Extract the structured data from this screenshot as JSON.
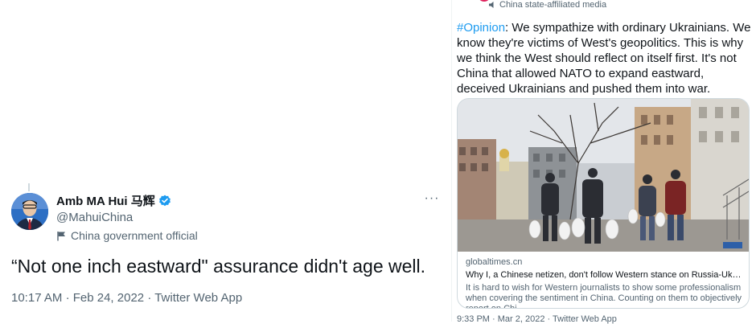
{
  "left_tweet": {
    "author_name": "Amb MA Hui 马辉",
    "handle": "@MahuiChina",
    "label": "China government official",
    "text": "“Not one inch eastward\" assurance didn't age well.",
    "time": "10:17 AM",
    "date": "Feb 24, 2022",
    "source": "Twitter Web App",
    "more": "···"
  },
  "right_tweet": {
    "state_label": "China state-affiliated media",
    "hashtag": "#Opinion",
    "text": ": We sympathize with ordinary Ukrainians. We know they're victims of West's geopolitics. This is why we think the West should reflect on itself first. It's not China that allowed NATO to expand eastward, deceived Ukrainians and pushed them into war.",
    "card": {
      "domain": "globaltimes.cn",
      "title": "Why I, a Chinese netizen, don't follow Western stance on Russia-Ukraine conflict",
      "description": "It is hard to wish for Western journalists to show some professionalism when covering the sentiment in China. Counting on them to objectively report on Chi..."
    },
    "meta": "9:33 PM · Mar 2, 2022 · Twitter Web App"
  },
  "colors": {
    "link": "#1d9bf0",
    "verified": "#1d9bf0",
    "secondary_text": "#536471",
    "state_badge": "#e0245e"
  }
}
